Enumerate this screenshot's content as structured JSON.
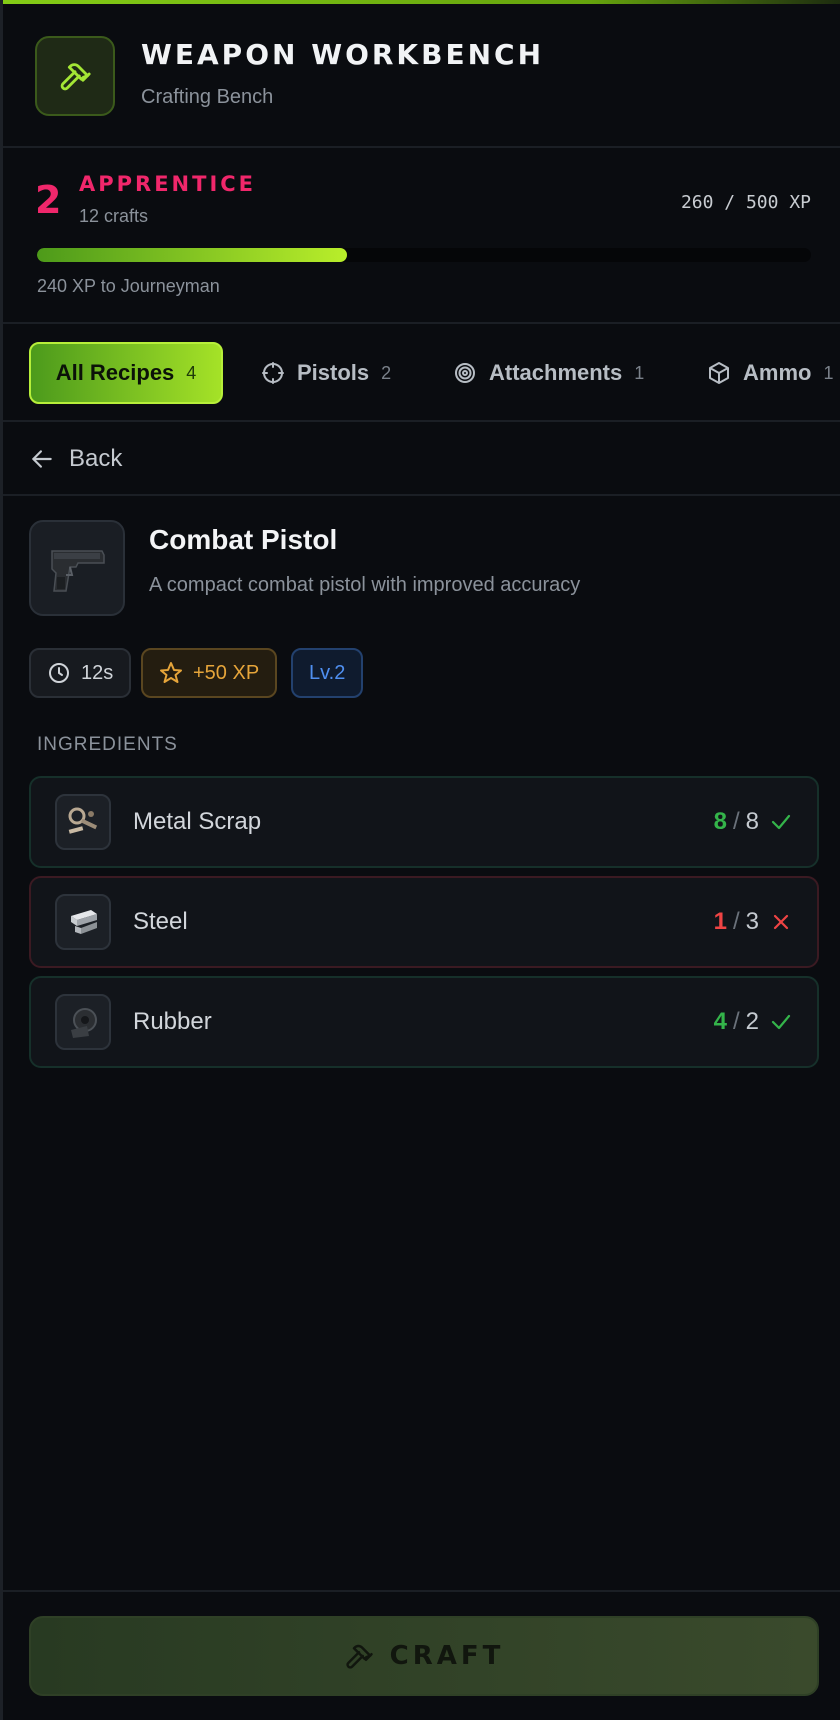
{
  "header": {
    "title": "WEAPON WORKBENCH",
    "subtitle": "Crafting Bench",
    "icon": "hammer-icon"
  },
  "level": {
    "number": "2",
    "name": "APPRENTICE",
    "crafts": "12 crafts",
    "xp": "260 / 500 XP",
    "progress": 0.4,
    "next": "240 XP to Journeyman"
  },
  "tabs": [
    {
      "label": "All Recipes",
      "count": "4",
      "icon": "none",
      "active": true
    },
    {
      "label": "Pistols",
      "count": "2",
      "icon": "crosshair-icon"
    },
    {
      "label": "Attachments",
      "count": "1",
      "icon": "target-icon"
    },
    {
      "label": "Ammo",
      "count": "1",
      "icon": "box-icon"
    }
  ],
  "back_label": "Back",
  "recipe": {
    "name": "Combat Pistol",
    "description": "A compact combat pistol with improved accuracy",
    "time": "12s",
    "xp": "+50 XP",
    "level": "Lv.2"
  },
  "ingredients_title": "INGREDIENTS",
  "ingredients": [
    {
      "name": "Metal Scrap",
      "have": "8",
      "need": "8",
      "ok": true,
      "icon": "metal-scrap-icon"
    },
    {
      "name": "Steel",
      "have": "1",
      "need": "3",
      "ok": false,
      "icon": "steel-icon"
    },
    {
      "name": "Rubber",
      "have": "4",
      "need": "2",
      "ok": true,
      "icon": "rubber-icon"
    }
  ],
  "craft_label": "CRAFT",
  "colors": {
    "accent": "#84cc16",
    "level": "#f0276b",
    "ok": "#34b44a",
    "bad": "#ef4444",
    "xp": "#e6a53a",
    "lvl": "#4f8ff0"
  }
}
